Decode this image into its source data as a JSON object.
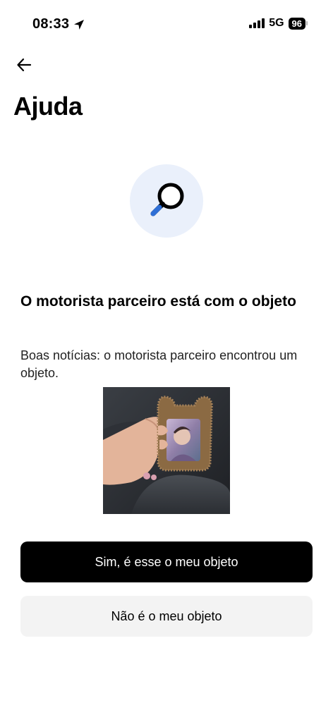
{
  "status_bar": {
    "time": "08:33",
    "network": "5G",
    "battery": "96"
  },
  "header": {
    "title": "Ajuda"
  },
  "content": {
    "heading": "O motorista parceiro está com o objeto",
    "description": "Boas notícias: o motorista parceiro encontrou um objeto."
  },
  "actions": {
    "confirm_label": "Sim, é esse o meu objeto",
    "deny_label": "Não é o meu objeto"
  },
  "colors": {
    "hero_bg": "#eaf0fb",
    "primary_button": "#000000",
    "secondary_button": "#f3f3f3"
  }
}
